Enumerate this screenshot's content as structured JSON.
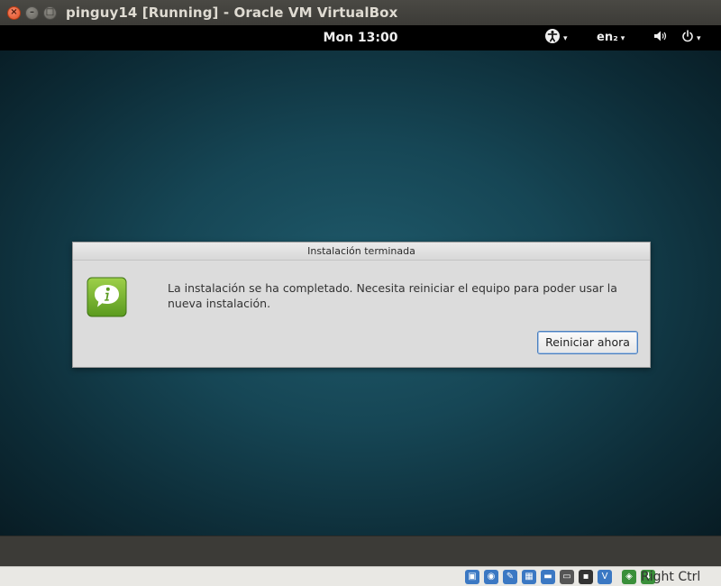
{
  "window": {
    "title": "pinguy14 [Running] - Oracle VM VirtualBox",
    "close_glyph": "×",
    "minimize_glyph": "–",
    "maximize_glyph": "□"
  },
  "guest_panel": {
    "clock": "Mon 13:00",
    "accessibility_icon": "accessibility-icon",
    "keyboard_layout": "en₂",
    "volume_icon": "volume-icon",
    "power_icon": "power-icon",
    "dropdown_glyph": "▾"
  },
  "dialog": {
    "title": "Instalación terminada",
    "icon": "info-icon",
    "icon_color": "#6aa526",
    "message": "La instalación se ha completado. Necesita reiniciar el equipo para poder usar la nueva instalación.",
    "button_label": "Reiniciar ahora"
  },
  "statusbar": {
    "icons": [
      {
        "name": "hard-disk-icon",
        "glyph": "▣",
        "color": "#3b78c3"
      },
      {
        "name": "optical-drive-icon",
        "glyph": "◉",
        "color": "#3b78c3"
      },
      {
        "name": "usb-icon",
        "glyph": "✎",
        "color": "#3b78c3"
      },
      {
        "name": "network-icon",
        "glyph": "▦",
        "color": "#3b78c3"
      },
      {
        "name": "shared-folders-icon",
        "glyph": "▬",
        "color": "#3b78c3"
      },
      {
        "name": "display-icon",
        "glyph": "▭",
        "color": "#555555"
      },
      {
        "name": "video-capture-icon",
        "glyph": "▪",
        "color": "#333333"
      },
      {
        "name": "cpu-icon",
        "glyph": "V",
        "color": "#3b78c3"
      },
      {
        "name": "mouse-integration-icon",
        "glyph": "◈",
        "color": "#3a8f3a"
      },
      {
        "name": "keyboard-capture-icon",
        "glyph": "⬇",
        "color": "#3a8f3a"
      }
    ],
    "host_key_label": "Right Ctrl"
  }
}
